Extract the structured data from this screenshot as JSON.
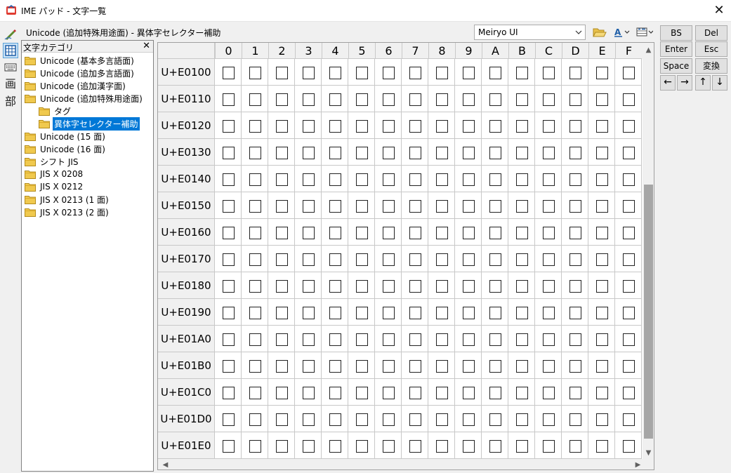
{
  "window": {
    "title": "IME パッド - 文字一覧",
    "close_glyph": "✕"
  },
  "tools": [
    {
      "name": "handwriting-tool",
      "icon": "pen-icon"
    },
    {
      "name": "char-list-tool",
      "icon": "char-list-icon"
    },
    {
      "name": "soft-keyboard-tool",
      "icon": "keyboard-icon"
    },
    {
      "name": "stroke-count-tool",
      "label": "画"
    },
    {
      "name": "radical-tool",
      "label": "部"
    }
  ],
  "header": {
    "path": "Unicode (追加特殊用途面) - 異体字セレクター補助",
    "font": "Meiryo UI"
  },
  "category_pane": {
    "title": "文字カテゴリ",
    "close_glyph": "✕",
    "items": [
      {
        "label": "Unicode (基本多言語面)",
        "level": 0
      },
      {
        "label": "Unicode (追加多言語面)",
        "level": 0
      },
      {
        "label": "Unicode (追加漢字面)",
        "level": 0
      },
      {
        "label": "Unicode (追加特殊用途面)",
        "level": 0
      },
      {
        "label": "タグ",
        "level": 1
      },
      {
        "label": "異体字セレクター補助",
        "level": 1,
        "selected": true
      },
      {
        "label": "Unicode (15 面)",
        "level": 0
      },
      {
        "label": "Unicode (16 面)",
        "level": 0
      },
      {
        "label": "シフト JIS",
        "level": 0
      },
      {
        "label": "JIS X 0208",
        "level": 0
      },
      {
        "label": "JIS X 0212",
        "level": 0
      },
      {
        "label": "JIS X 0213 (1 面)",
        "level": 0
      },
      {
        "label": "JIS X 0213 (2 面)",
        "level": 0
      }
    ]
  },
  "grid": {
    "columns": [
      "0",
      "1",
      "2",
      "3",
      "4",
      "5",
      "6",
      "7",
      "8",
      "9",
      "A",
      "B",
      "C",
      "D",
      "E",
      "F"
    ],
    "rows": [
      "U+E0100",
      "U+E0110",
      "U+E0120",
      "U+E0130",
      "U+E0140",
      "U+E0150",
      "U+E0160",
      "U+E0170",
      "U+E0180",
      "U+E0190",
      "U+E01A0",
      "U+E01B0",
      "U+E01C0",
      "U+E01D0",
      "U+E01E0"
    ],
    "cell_glyph": "empty-box",
    "scroll_position": 0.43
  },
  "keys": [
    {
      "name": "bs-key",
      "label": "BS"
    },
    {
      "name": "del-key",
      "label": "Del"
    },
    {
      "name": "enter-key",
      "label": "Enter"
    },
    {
      "name": "esc-key",
      "label": "Esc"
    },
    {
      "name": "space-key",
      "label": "Space"
    },
    {
      "name": "convert-key",
      "label": "変換"
    },
    {
      "name": "left-arrow-key",
      "label": "←"
    },
    {
      "name": "right-arrow-key",
      "label": "→"
    },
    {
      "name": "up-arrow-key",
      "label": "↑"
    },
    {
      "name": "down-arrow-key",
      "label": "↓"
    }
  ],
  "colors": {
    "selection": "#0078d7",
    "folder": "#e8c04a",
    "tool_selected": "#cce4f7"
  }
}
